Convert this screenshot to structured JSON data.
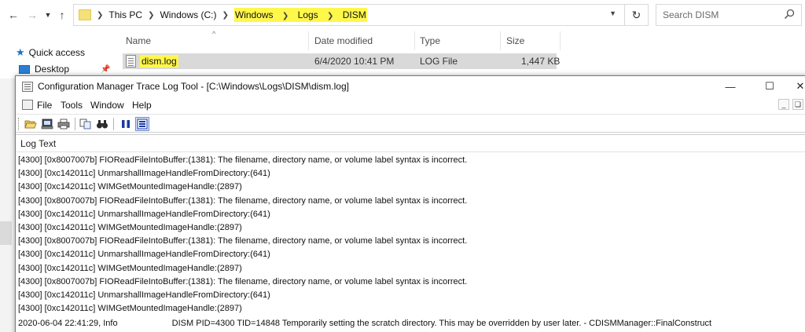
{
  "explorer": {
    "breadcrumb": [
      "This PC",
      "Windows (C:)",
      "Windows",
      "Logs",
      "DISM"
    ],
    "search_placeholder": "Search DISM",
    "nav_items": [
      {
        "label": "Quick access"
      },
      {
        "label": "Desktop"
      }
    ],
    "columns": {
      "name": "Name",
      "date": "Date modified",
      "type": "Type",
      "size": "Size"
    },
    "files": [
      {
        "name": "dism.log",
        "date": "6/4/2020 10:41 PM",
        "type": "LOG File",
        "size": "1,447 KB"
      }
    ],
    "highlight_color": "#fff74a"
  },
  "cmtrace": {
    "title": "Configuration Manager Trace Log Tool - [C:\\Windows\\Logs\\DISM\\dism.log]",
    "menu": [
      "File",
      "Tools",
      "Window",
      "Help"
    ],
    "toolbar_icons": [
      "open-icon",
      "print-setup-icon",
      "print-icon",
      "copy-icon",
      "find-icon",
      "pause-icon",
      "highlight-icon"
    ],
    "log_header": "Log Text",
    "log_lines": [
      "[4300] [0x8007007b] FIOReadFileIntoBuffer:(1381): The filename, directory name, or volume label syntax is incorrect.",
      "[4300] [0xc142011c] UnmarshallImageHandleFromDirectory:(641)",
      "[4300] [0xc142011c] WIMGetMountedImageHandle:(2897)",
      "[4300] [0x8007007b] FIOReadFileIntoBuffer:(1381): The filename, directory name, or volume label syntax is incorrect.",
      "[4300] [0xc142011c] UnmarshallImageHandleFromDirectory:(641)",
      "[4300] [0xc142011c] WIMGetMountedImageHandle:(2897)",
      "[4300] [0x8007007b] FIOReadFileIntoBuffer:(1381): The filename, directory name, or volume label syntax is incorrect.",
      "[4300] [0xc142011c] UnmarshallImageHandleFromDirectory:(641)",
      "[4300] [0xc142011c] WIMGetMountedImageHandle:(2897)",
      "[4300] [0x8007007b] FIOReadFileIntoBuffer:(1381): The filename, directory name, or volume label syntax is incorrect.",
      "[4300] [0xc142011c] UnmarshallImageHandleFromDirectory:(641)",
      "[4300] [0xc142011c] WIMGetMountedImageHandle:(2897)"
    ],
    "status_line": {
      "timestamp": "2020-06-04 22:41:29, Info",
      "message": "DISM   PID=4300 TID=14848 Temporarily setting the scratch directory. This may be overridden by user later. - CDISMManager::FinalConstruct"
    }
  }
}
